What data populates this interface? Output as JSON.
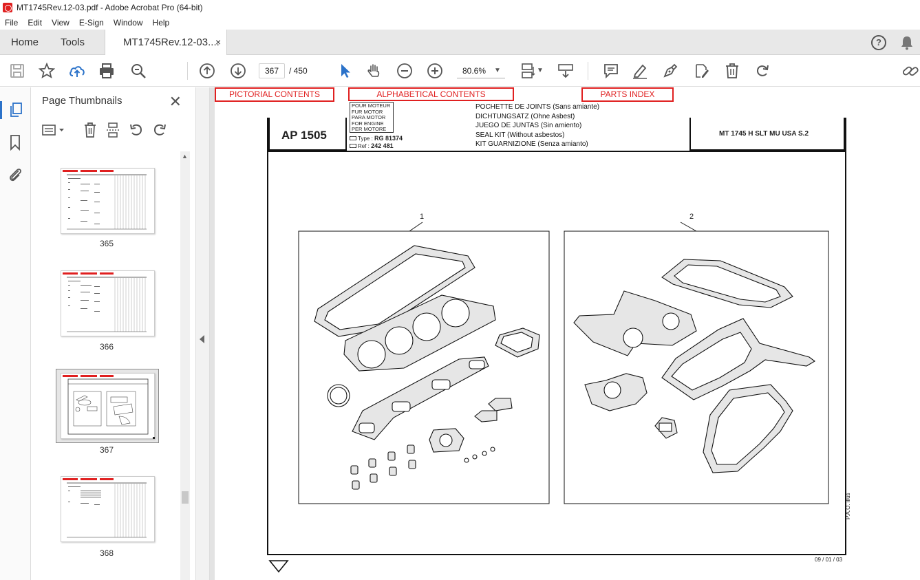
{
  "window": {
    "title": "MT1745Rev.12-03.pdf - Adobe Acrobat Pro (64-bit)"
  },
  "menu": [
    "File",
    "Edit",
    "View",
    "E-Sign",
    "Window",
    "Help"
  ],
  "tabs": {
    "home": "Home",
    "tools": "Tools",
    "document": "MT1745Rev.12-03....",
    "close": "×"
  },
  "toolbar": {
    "current_page": "367",
    "page_total": "/  450",
    "zoom": "80.6%"
  },
  "thumbnails": {
    "title": "Page Thumbnails",
    "close": "✕",
    "pages": [
      {
        "label": "365"
      },
      {
        "label": "366"
      },
      {
        "label": "367",
        "selected": true
      },
      {
        "label": "368"
      }
    ]
  },
  "document": {
    "links": {
      "pictorial": "PICTORIAL CONTENTS",
      "alphabetical": "ALPHABETICAL CONTENTS",
      "parts_index": "PARTS INDEX"
    },
    "ap_code": "AP  1505",
    "engine_labels": [
      "POUR MOTEUR",
      "FUR MOTOR",
      "PARA MOTOR",
      "FOR ENGINE",
      "PER MOTORE"
    ],
    "type_label": "Type :",
    "type_value": "RG 81374",
    "ref_label": "Ref :",
    "ref_value": "242 481",
    "descriptions": [
      "POCHETTE DE JOINTS (Sans amiante)",
      "DICHTUNGSATZ (Ohne Asbest)",
      "JUEGO DE JUNTAS (Sin amiento)",
      "SEAL KIT (Without asbestos)",
      "KIT GUARNIZIONE (Senza amianto)"
    ],
    "model": "MT 1745 H SLT MU USA S.2",
    "item1": "1",
    "item2": "2",
    "side_note": "P.A.O. illus",
    "date": "09 / 01 / 03"
  },
  "colors": {
    "accent_blue": "#2b72c9",
    "link_red": "#e02020"
  }
}
